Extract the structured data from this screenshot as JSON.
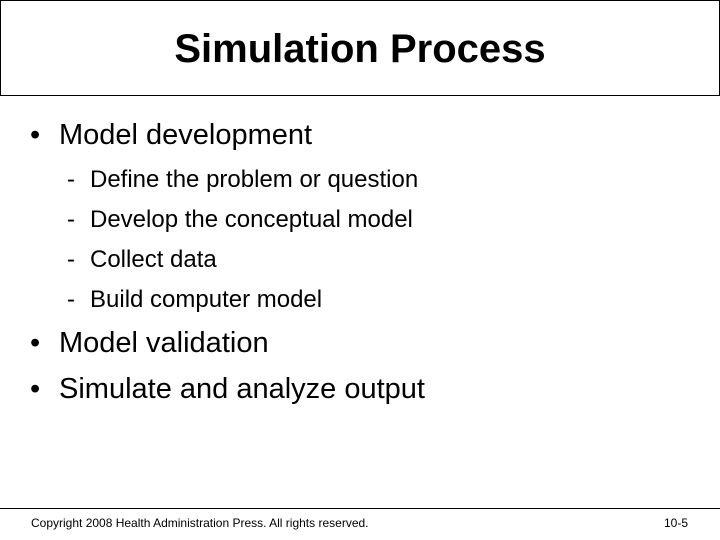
{
  "slide": {
    "title": "Simulation Process",
    "bullets": [
      {
        "text": "Model development",
        "subitems": [
          "Define the problem or question",
          "Develop the conceptual model",
          "Collect data",
          "Build computer model"
        ]
      },
      {
        "text": "Model validation"
      },
      {
        "text": "Simulate and analyze output"
      }
    ],
    "bullet_marker": "•",
    "sub_marker": "-"
  },
  "footer": {
    "copyright": "Copyright 2008 Health Administration Press. All rights reserved.",
    "page_number": "10-5"
  }
}
